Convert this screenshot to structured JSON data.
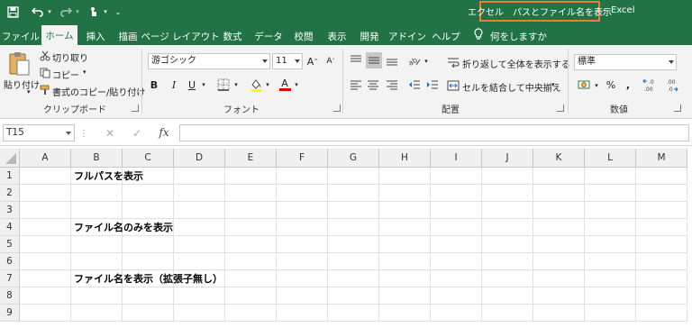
{
  "title": {
    "document": "エクセル　パスとファイル名を表示",
    "separator": "-",
    "app": "Excel"
  },
  "qat": {
    "save_icon": "save-icon",
    "undo_icon": "undo-icon",
    "redo_icon": "redo-icon",
    "touch_icon": "touch-mode-icon",
    "customize_icon": "customize-qat-icon"
  },
  "tabs": [
    "ファイル",
    "ホーム",
    "挿入",
    "描画",
    "ページ レイアウト",
    "数式",
    "データ",
    "校閲",
    "表示",
    "開発",
    "アドイン",
    "ヘルプ"
  ],
  "tell_me": "何をしますか",
  "ribbon": {
    "clipboard": {
      "paste": "貼り付け",
      "cut": "切り取り",
      "copy": "コピー",
      "format_painter": "書式のコピー/貼り付け",
      "label": "クリップボード"
    },
    "font": {
      "name": "游ゴシック",
      "size": "11",
      "grow": "A",
      "shrink": "A",
      "bold": "B",
      "italic": "I",
      "underline": "U",
      "font_color": "A",
      "label": "フォント"
    },
    "alignment": {
      "wrap": "折り返して全体を表示する",
      "merge": "セルを結合して中央揃え",
      "label": "配置"
    },
    "number": {
      "format": "標準",
      "percent": "%",
      "comma": ",",
      "label": "数値"
    }
  },
  "formula_bar": {
    "name_box": "T15",
    "fx": "fx",
    "cancel": "✕",
    "enter": "✓"
  },
  "columns": [
    "A",
    "B",
    "C",
    "D",
    "E",
    "F",
    "G",
    "H",
    "I",
    "J",
    "K",
    "L",
    "M"
  ],
  "rows": [
    "1",
    "2",
    "3",
    "4",
    "5",
    "6",
    "7",
    "8",
    "9"
  ],
  "cells": {
    "B1": "フルパスを表示",
    "B4": "ファイル名のみを表示",
    "B7": "ファイル名を表示（拡張子無し）"
  }
}
